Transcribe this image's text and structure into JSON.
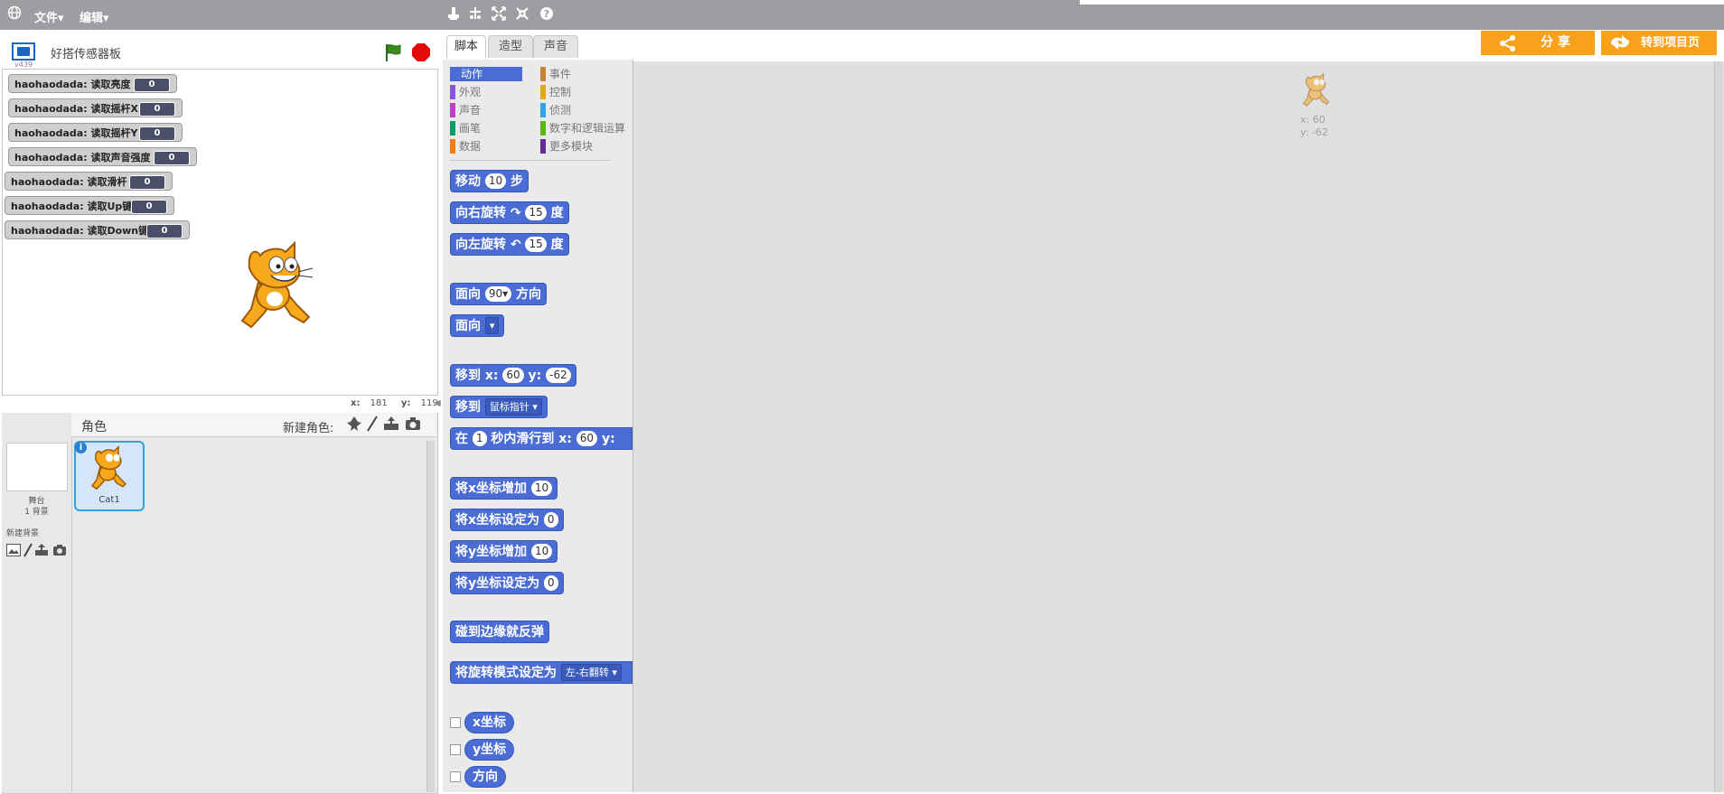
{
  "topbar": {
    "menu_file": "文件",
    "menu_edit": "编辑",
    "caret": "▾"
  },
  "stage": {
    "title": "好搭传感器板",
    "version": "v439",
    "monitors": [
      {
        "label": "haohaodada: 读取亮度",
        "value": "0"
      },
      {
        "label": "haohaodada: 读取摇杆X",
        "value": "0"
      },
      {
        "label": "haohaodada: 读取摇杆Y",
        "value": "0"
      },
      {
        "label": "haohaodada: 读取声音强度",
        "value": "0"
      },
      {
        "label": "haohaodada: 读取滑杆",
        "value": "0"
      },
      {
        "label": "haohaodada: 读取Up键",
        "value": "0"
      },
      {
        "label": "haohaodada: 读取Down键",
        "value": "0"
      }
    ],
    "coords": {
      "x_label": "x:",
      "x_value": "181",
      "y_label": "y:",
      "y_value": "119"
    }
  },
  "sprites": {
    "header_label": "角色",
    "new_sprite_label": "新建角色:",
    "stage_label": "舞台",
    "stage_sub": "1 背景",
    "new_backdrop_label": "新建背景",
    "items": [
      {
        "name": "Cat1"
      }
    ]
  },
  "tabs": [
    {
      "label": "脚本"
    },
    {
      "label": "造型"
    },
    {
      "label": "声音"
    }
  ],
  "buttons": {
    "share": "分 享",
    "goto_project": "转到项目页"
  },
  "categories": {
    "left": [
      {
        "label": "动作",
        "color": "#4a6cd4"
      },
      {
        "label": "外观",
        "color": "#8a55d7"
      },
      {
        "label": "声音",
        "color": "#bb42c3"
      },
      {
        "label": "画笔",
        "color": "#0e9a6c"
      },
      {
        "label": "数据",
        "color": "#ee7d16"
      }
    ],
    "right": [
      {
        "label": "事件",
        "color": "#c88330"
      },
      {
        "label": "控制",
        "color": "#e1a91a"
      },
      {
        "label": "侦测",
        "color": "#2ca5e2"
      },
      {
        "label": "数字和逻辑运算",
        "color": "#5cb712"
      },
      {
        "label": "更多模块",
        "color": "#632d99"
      }
    ]
  },
  "blocks": {
    "move": {
      "text": "移动",
      "value": "10",
      "suffix": "步"
    },
    "turn_right": {
      "text": "向右旋转",
      "value": "15",
      "suffix": "度"
    },
    "turn_left": {
      "text": "向左旋转",
      "value": "15",
      "suffix": "度"
    },
    "point_dir": {
      "text": "面向",
      "value": "90▾",
      "suffix": "方向"
    },
    "point_towards": {
      "text": "面向",
      "value": "▾"
    },
    "goto_xy": {
      "text": "移到 x:",
      "x": "60",
      "y_label": "y:",
      "y": "-62"
    },
    "goto": {
      "text": "移到",
      "value": "鼠标指针 ▾"
    },
    "glide": {
      "text": "在",
      "secs": "1",
      "mid": "秒内滑行到 x:",
      "x": "60",
      "y_label": "y:"
    },
    "change_x": {
      "text": "将x坐标增加",
      "value": "10"
    },
    "set_x": {
      "text": "将x坐标设定为",
      "value": "0"
    },
    "change_y": {
      "text": "将y坐标增加",
      "value": "10"
    },
    "set_y": {
      "text": "将y坐标设定为",
      "value": "0"
    },
    "bounce": {
      "text": "碰到边缘就反弹"
    },
    "rotation_style": {
      "text": "将旋转模式设定为",
      "value": "左-右翻转 ▾"
    },
    "reporters": [
      {
        "label": "x坐标"
      },
      {
        "label": "y坐标"
      },
      {
        "label": "方向"
      }
    ]
  },
  "scripts": {
    "sprite_x": "x: 60",
    "sprite_y": "y: -62"
  }
}
